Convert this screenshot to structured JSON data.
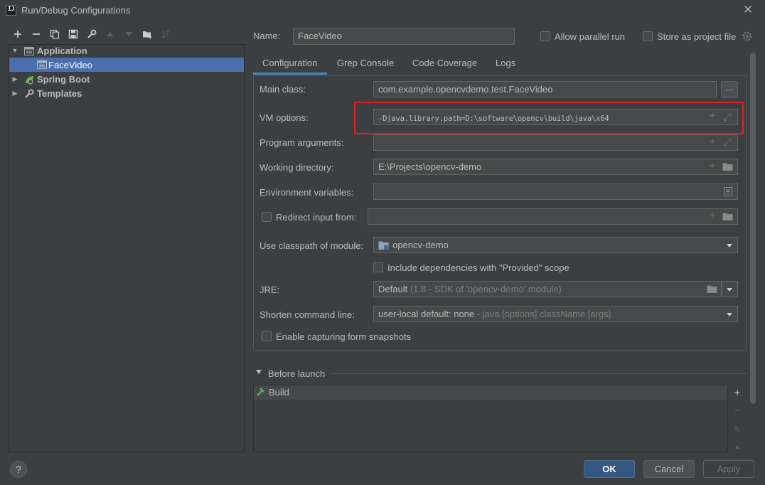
{
  "window": {
    "title": "Run/Debug Configurations",
    "logo_text": "IJ"
  },
  "toolbar": {
    "add": "+",
    "remove": "−"
  },
  "tree": {
    "items": [
      {
        "label": "Application",
        "bold": true
      },
      {
        "label": "FaceVideo",
        "bold": false,
        "selected": true
      },
      {
        "label": "Spring Boot",
        "bold": true
      },
      {
        "label": "Templates",
        "bold": true
      }
    ]
  },
  "header": {
    "name_label": "Name:",
    "name_value": "FaceVideo",
    "allow_parallel_label": "Allow parallel run",
    "store_as_project_label": "Store as project file"
  },
  "tabs": [
    {
      "label": "Configuration",
      "active": true
    },
    {
      "label": "Grep Console"
    },
    {
      "label": "Code Coverage"
    },
    {
      "label": "Logs"
    }
  ],
  "form": {
    "main_class_label": "Main class:",
    "main_class_value": "com.example.opencvdemo.test.FaceVideo",
    "dots_label": "...",
    "vm_options_label": "VM options:",
    "vm_options_value": "-Djava.library.path=D:\\software\\opencv\\build\\java\\x64",
    "program_args_label": "Program arguments:",
    "working_dir_label": "Working directory:",
    "working_dir_value": "E:\\Projects\\opencv-demo",
    "env_vars_label": "Environment variables:",
    "redirect_label": "Redirect input from:",
    "classpath_label": "Use classpath of module:",
    "classpath_value": "opencv-demo",
    "include_deps_label": "Include dependencies with \"Provided\" scope",
    "jre_label": "JRE:",
    "jre_value": "Default",
    "jre_hint": "(1.8 - SDK of 'opencv-demo' module)",
    "shorten_label": "Shorten command line:",
    "shorten_value": "user-local default: none",
    "shorten_hint": "- java [options] className [args]",
    "snapshots_label": "Enable capturing form snapshots"
  },
  "before_launch": {
    "label": "Before launch",
    "tasks": [
      {
        "label": "Build"
      }
    ]
  },
  "buttons": {
    "help": "?",
    "ok": "OK",
    "cancel": "Cancel",
    "apply": "Apply"
  },
  "colors": {
    "accent": "#4b6eaf",
    "tab_underline": "#4a88c7",
    "highlight": "#e02020",
    "ok_bg": "#365880"
  }
}
